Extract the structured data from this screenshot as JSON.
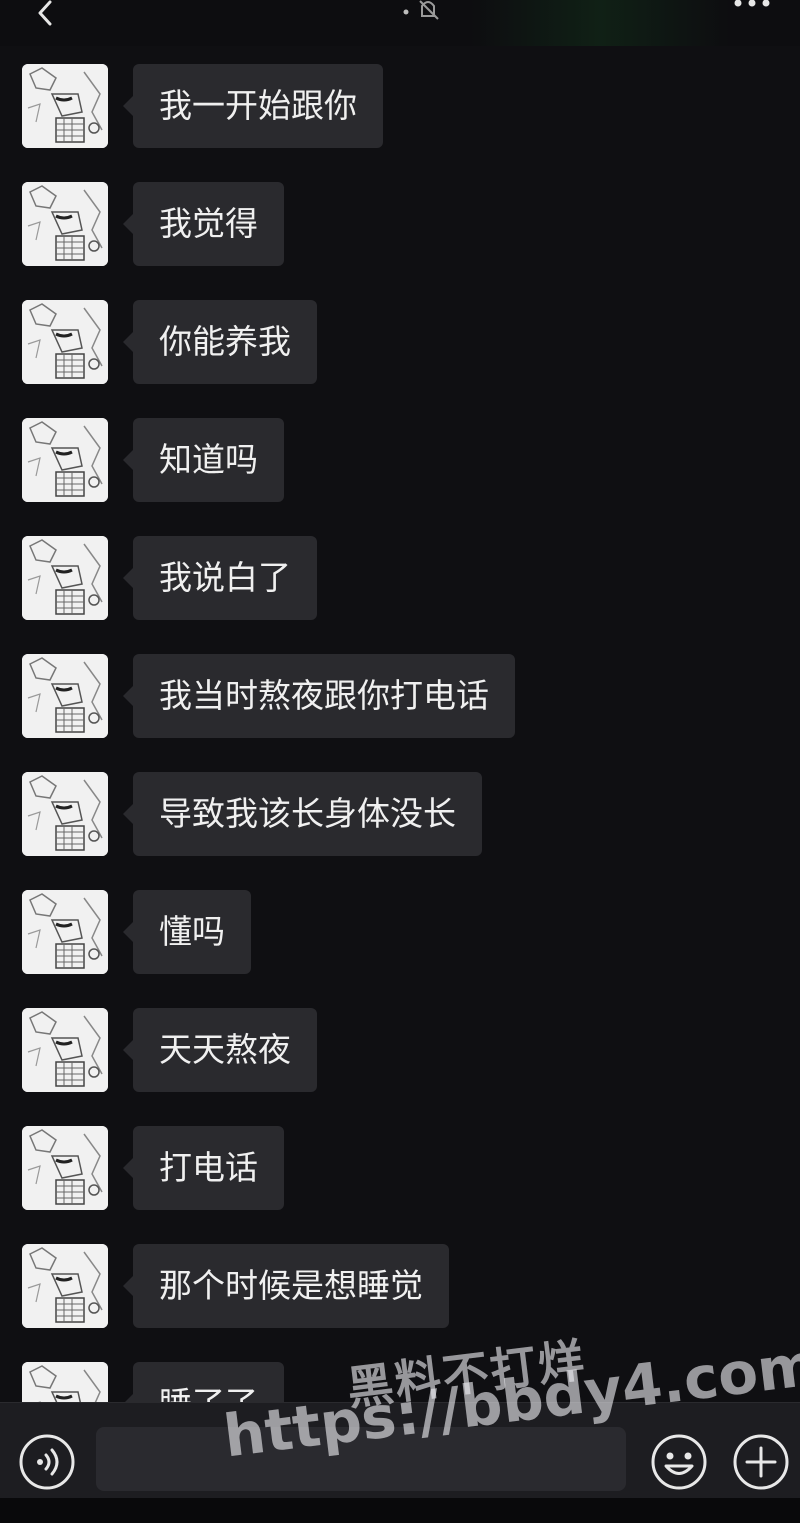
{
  "topbar": {
    "back_icon": "chevron-left-icon",
    "status_icon": "muted-bell-icon",
    "more_icon": "more-dots-icon"
  },
  "messages": [
    {
      "text": "我一开始跟你"
    },
    {
      "text": "我觉得"
    },
    {
      "text": "你能养我"
    },
    {
      "text": "知道吗"
    },
    {
      "text": "我说白了"
    },
    {
      "text": "我当时熬夜跟你打电话"
    },
    {
      "text": "导致我该长身体没长"
    },
    {
      "text": "懂吗"
    },
    {
      "text": "天天熬夜"
    },
    {
      "text": "打电话"
    },
    {
      "text": "那个时候是想睡觉"
    },
    {
      "text": "睡了了"
    }
  ],
  "inputbar": {
    "voice_icon": "voice-icon",
    "message_value": "",
    "emoji_icon": "emoji-icon",
    "plus_icon": "plus-icon"
  },
  "watermark": {
    "line1": "黑料不打烊",
    "line2": "https://bbdy4.com"
  },
  "colors": {
    "background": "#0f0f12",
    "bubble": "#2a2a2e",
    "bubble_text": "#f0f0f0",
    "inputbar": "#1d1d21"
  }
}
